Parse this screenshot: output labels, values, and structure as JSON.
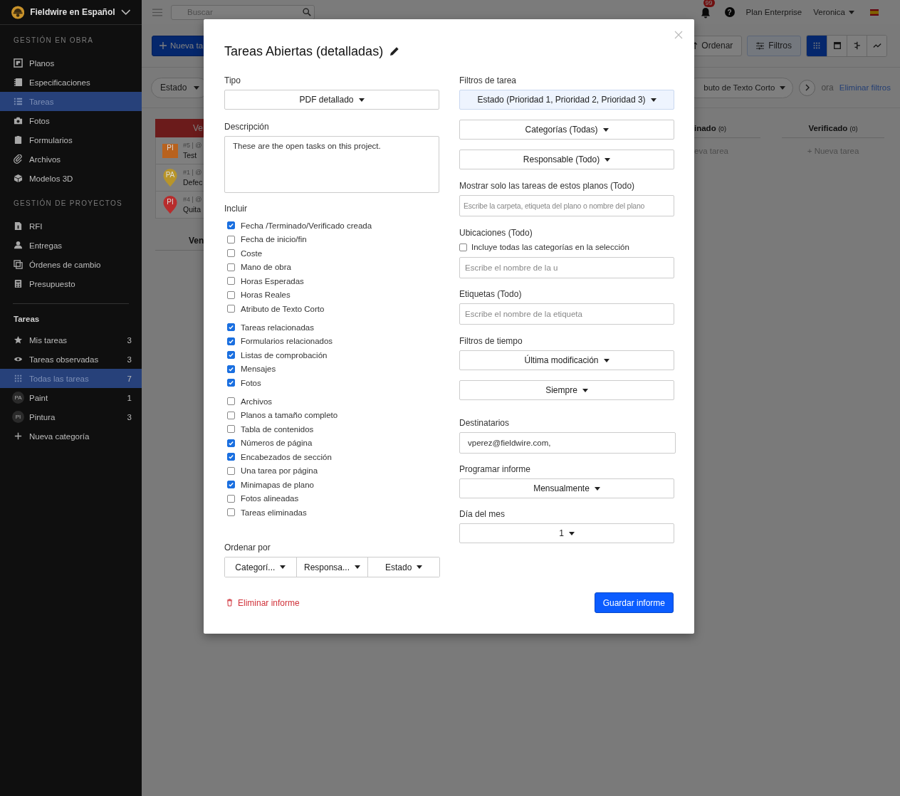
{
  "sidebar": {
    "project": "Fieldwire en Español",
    "sections": [
      {
        "heading": "GESTIÓN EN OBRA",
        "items": [
          {
            "label": "Planos",
            "selected": false
          },
          {
            "label": "Especificaciones",
            "selected": false
          },
          {
            "label": "Tareas",
            "selected": true
          },
          {
            "label": "Fotos",
            "selected": false
          },
          {
            "label": "Formularios",
            "selected": false
          },
          {
            "label": "Archivos",
            "selected": false
          },
          {
            "label": "Modelos 3D",
            "selected": false
          }
        ]
      },
      {
        "heading": "GESTIÓN DE PROYECTOS",
        "items": [
          {
            "label": "RFI",
            "selected": false
          },
          {
            "label": "Entregas",
            "selected": false
          },
          {
            "label": "Órdenes de cambio",
            "selected": false
          },
          {
            "label": "Presupuesto",
            "selected": false
          }
        ]
      }
    ],
    "tasks_heading": "Tareas",
    "task_views": [
      {
        "label": "Mis tareas",
        "count": "3",
        "selected": false
      },
      {
        "label": "Tareas observadas",
        "count": "3",
        "selected": false
      },
      {
        "label": "Todas las tareas",
        "count": "7",
        "selected": true
      },
      {
        "label": "Paint",
        "count": "1",
        "selected": false,
        "badge": "PA"
      },
      {
        "label": "Pintura",
        "count": "3",
        "selected": false,
        "badge": "PI"
      }
    ],
    "new_category": "Nueva categoría"
  },
  "topbar": {
    "search_placeholder": "Buscar",
    "notifications": "99",
    "help": "?",
    "plan": "Plan Enterprise",
    "user": "Veronica"
  },
  "toolbar": {
    "new_button": "Nueva ta",
    "sort_button": "Ordenar",
    "filters_button": "Filtros",
    "views": [
      {
        "selected": true
      },
      {
        "selected": false
      },
      {
        "selected": false
      },
      {
        "selected": false
      }
    ]
  },
  "filter_bar": {
    "status_filter": "Estado",
    "text_filter": "buto de Texto Corto",
    "faded_text": "ora",
    "clear_link": "Eliminar filtros"
  },
  "board": {
    "left_header": "Ve",
    "cards": [
      {
        "meta": "#5 | @",
        "title": "Test",
        "badge": "PI",
        "kind": "square",
        "color": "#b8621e"
      },
      {
        "meta": "#1 | @",
        "title": "Defec",
        "badge": "PA",
        "kind": "pin",
        "color": "#b8952a"
      },
      {
        "meta": "#4 | @",
        "title": "Quita",
        "badge": "PI",
        "kind": "pin",
        "color": "#b82c2c"
      }
    ],
    "lower_header": "Ven",
    "columns": [
      {
        "title": "inado",
        "count": "(0)",
        "add": "eva tarea"
      },
      {
        "title": "Verificado",
        "count": "(0)",
        "add": "+ Nueva tarea"
      }
    ]
  },
  "modal": {
    "title": "Tareas Abiertas (detalladas)",
    "type": {
      "label": "Tipo",
      "value": "PDF detallado"
    },
    "description": {
      "label": "Descripción",
      "value": "These are the open tasks on this project."
    },
    "include": {
      "label": "Incluir",
      "groups": [
        {
          "items": [
            {
              "label": "Fecha /Terminado/Verificado creada",
              "checked": true
            },
            {
              "label": "Fecha de inicio/fin",
              "checked": false
            },
            {
              "label": "Coste",
              "checked": false
            },
            {
              "label": "Mano de obra",
              "checked": false
            },
            {
              "label": "Horas Esperadas",
              "checked": false
            },
            {
              "label": "Horas Reales",
              "checked": false
            },
            {
              "label": "Atributo de Texto Corto",
              "checked": false
            }
          ]
        },
        {
          "items": [
            {
              "label": "Tareas relacionadas",
              "checked": true
            },
            {
              "label": "Formularios relacionados",
              "checked": true
            },
            {
              "label": "Listas de comprobación",
              "checked": true
            },
            {
              "label": "Mensajes",
              "checked": true
            },
            {
              "label": "Fotos",
              "checked": true
            }
          ]
        },
        {
          "items": [
            {
              "label": "Archivos",
              "checked": false
            },
            {
              "label": "Planos a tamaño completo",
              "checked": false
            },
            {
              "label": "Tabla de contenidos",
              "checked": false
            },
            {
              "label": "Números de página",
              "checked": true
            },
            {
              "label": "Encabezados de sección",
              "checked": true
            },
            {
              "label": "Una tarea por página",
              "checked": false
            },
            {
              "label": "Minimapas de plano",
              "checked": true
            },
            {
              "label": "Fotos alineadas",
              "checked": false
            },
            {
              "label": "Tareas eliminadas",
              "checked": false
            }
          ]
        }
      ]
    },
    "sort": {
      "label": "Ordenar por",
      "options": [
        "Categorí...",
        "Responsa...",
        "Estado"
      ]
    },
    "task_filters": {
      "label": "Filtros de tarea",
      "dropdowns": [
        {
          "value": "Estado (Prioridad 1, Prioridad 2, Prioridad 3)",
          "highlighted": true
        },
        {
          "value": "Categorías (Todas)",
          "highlighted": false
        },
        {
          "value": "Responsable (Todo)",
          "highlighted": false
        }
      ]
    },
    "plans": {
      "label": "Mostrar solo las tareas de estos planos (Todo)",
      "placeholder": "Escribe la carpeta, etiqueta del plano o nombre del plano"
    },
    "locations": {
      "label": "Ubicaciones (Todo)",
      "include_all": {
        "label": "Incluye todas las categorías en la selección",
        "checked": false
      },
      "placeholder": "Escribe el nombre de la u"
    },
    "tags": {
      "label": "Etiquetas (Todo)",
      "placeholder": "Escribe el nombre de la etiqueta"
    },
    "time_filters": {
      "label": "Filtros de tiempo",
      "dropdowns": [
        "Última modificación",
        "Siempre"
      ]
    },
    "recipients": {
      "label": "Destinatarios",
      "value": "vperez@fieldwire.com,"
    },
    "schedule": {
      "label": "Programar informe",
      "value": "Mensualmente"
    },
    "day": {
      "label": "Día del mes",
      "value": "1"
    },
    "delete": "Eliminar informe",
    "save": "Guardar informe"
  }
}
